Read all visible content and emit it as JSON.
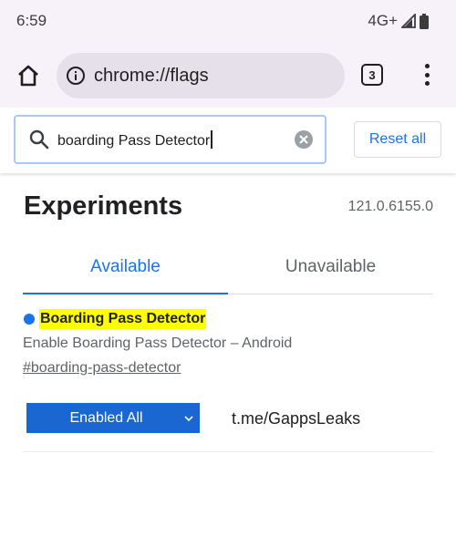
{
  "status_bar": {
    "time": "6:59",
    "network": "4G+"
  },
  "toolbar": {
    "url": "chrome://flags",
    "tab_count": "3"
  },
  "search": {
    "value": "boarding Pass Detector",
    "reset_label": "Reset all"
  },
  "page": {
    "title": "Experiments",
    "version": "121.0.6155.0"
  },
  "tabs": [
    {
      "label": "Available",
      "selected": true
    },
    {
      "label": "Unavailable",
      "selected": false
    }
  ],
  "flag": {
    "name": "Boarding Pass Detector",
    "description": "Enable Boarding Pass Detector – Android",
    "link": "#boarding-pass-detector",
    "selected_option": "Enabled All",
    "side_text": "t.me/GappsLeaks"
  },
  "colors": {
    "accent": "#1a73e8",
    "highlight": "#ffff00",
    "chrome_bar": "#f7f2f9"
  }
}
